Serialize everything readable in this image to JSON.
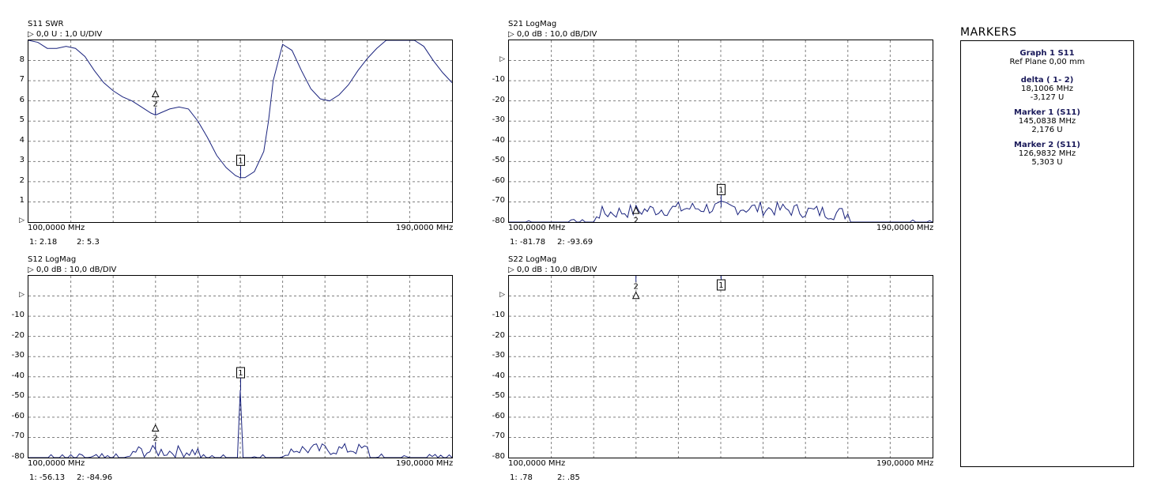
{
  "graphs": [
    {
      "id": "s11",
      "param": "S11",
      "format": "SWR",
      "scale": "0,0 U : 1,0 U/DIV",
      "y_ticks": [
        "8",
        "7",
        "6",
        "5",
        "4",
        "3",
        "2",
        "1",
        ""
      ],
      "x_start": "100,0000 MHz",
      "x_stop": "190,0000 MHz",
      "readout_1": "1:  2.18",
      "readout_2": "2:  5.3",
      "marker_1": "1",
      "marker_2": "2"
    },
    {
      "id": "s21",
      "param": "S21",
      "format": "LogMag",
      "scale": "0,0 dB : 10,0 dB/DIV",
      "y_ticks": [
        "",
        "-10",
        "-20",
        "-30",
        "-40",
        "-50",
        "-60",
        "-70",
        "-80"
      ],
      "x_start": "100,0000 MHz",
      "x_stop": "190,0000 MHz",
      "readout_1": "1:  -81.78",
      "readout_2": "2:  -93.69",
      "marker_1": "1",
      "marker_2": "2"
    },
    {
      "id": "s12",
      "param": "S12",
      "format": "LogMag",
      "scale": "0,0 dB : 10,0 dB/DIV",
      "y_ticks": [
        "",
        "-10",
        "-20",
        "-30",
        "-40",
        "-50",
        "-60",
        "-70",
        "-80"
      ],
      "x_start": "100,0000 MHz",
      "x_stop": "190,0000 MHz",
      "readout_1": "1:  -56.13",
      "readout_2": "2:  -84.96",
      "marker_1": "1",
      "marker_2": "2"
    },
    {
      "id": "s22",
      "param": "S22",
      "format": "LogMag",
      "scale": "0,0 dB : 10,0 dB/DIV",
      "y_ticks": [
        "",
        "-10",
        "-20",
        "-30",
        "-40",
        "-50",
        "-60",
        "-70",
        "-80"
      ],
      "x_start": "100,0000 MHz",
      "x_stop": "190,0000 MHz",
      "readout_1": "1:  .78",
      "readout_2": "2:  .85",
      "marker_1": "1",
      "marker_2": "2"
    }
  ],
  "markers_panel": {
    "title": "MARKERS",
    "graph_title": "Graph 1 S11",
    "ref_plane": "Ref Plane 0,00 mm",
    "delta_title": "delta ( 1- 2)",
    "delta_freq": "18,1006 MHz",
    "delta_val": "-3,127 U",
    "m1_title": "Marker  1 (S11)",
    "m1_freq": "145,0838 MHz",
    "m1_val": "2,176 U",
    "m2_title": "Marker  2 (S11)",
    "m2_freq": "126,9832 MHz",
    "m2_val": "5,303 U"
  },
  "colors": {
    "trace": "#1a237e",
    "grid": "#808080"
  },
  "chart_data": [
    {
      "type": "line",
      "title": "S11 SWR",
      "x_range_mhz": [
        100,
        190
      ],
      "ylim": [
        0,
        9
      ],
      "x": [
        100,
        102,
        104,
        106,
        108,
        110,
        112,
        114,
        116,
        118,
        120,
        122,
        124,
        126,
        127,
        128,
        130,
        132,
        134,
        136,
        138,
        140,
        142,
        144,
        145,
        146,
        148,
        150,
        151,
        152,
        154,
        156,
        158,
        160,
        162,
        164,
        166,
        168,
        170,
        172,
        174,
        176,
        178,
        180,
        182,
        184,
        186,
        188,
        190
      ],
      "series": [
        {
          "values": [
            9.5,
            8.9,
            8.6,
            8.6,
            8.7,
            8.6,
            8.2,
            7.5,
            6.9,
            6.5,
            6.2,
            6.0,
            5.7,
            5.4,
            5.3,
            5.4,
            5.6,
            5.7,
            5.6,
            5.0,
            4.2,
            3.3,
            2.7,
            2.3,
            2.2,
            2.2,
            2.5,
            3.5,
            5.0,
            7.0,
            8.8,
            8.5,
            7.5,
            6.6,
            6.1,
            6.0,
            6.3,
            6.8,
            7.5,
            8.1,
            8.6,
            9.1,
            9.4,
            9.5,
            9.3,
            8.7,
            8.0,
            7.4,
            6.9
          ]
        }
      ],
      "markers": [
        {
          "label": "1",
          "x": 145.0838,
          "y": 2.18
        },
        {
          "label": "2",
          "x": 126.9832,
          "y": 5.3
        }
      ]
    },
    {
      "type": "line",
      "title": "S21 LogMag",
      "x_range_mhz": [
        100,
        190
      ],
      "ylim": [
        -89,
        0
      ],
      "series": [
        {
          "values": "noise floor approximately -80 to -93 dB across the span"
        }
      ],
      "markers": [
        {
          "label": "1",
          "x": 145.0838,
          "y": -81.78
        },
        {
          "label": "2",
          "x": 126.9832,
          "y": -93.69
        }
      ]
    },
    {
      "type": "line",
      "title": "S12 LogMag",
      "x_range_mhz": [
        100,
        190
      ],
      "ylim": [
        -89,
        0
      ],
      "series": [
        {
          "values": "noise floor approximately -85 to -92 dB with a spike to -56 dB near 145 MHz"
        }
      ],
      "markers": [
        {
          "label": "1",
          "x": 145.0838,
          "y": -56.13
        },
        {
          "label": "2",
          "x": 126.9832,
          "y": -84.96
        }
      ]
    },
    {
      "type": "line",
      "title": "S22 LogMag",
      "x_range_mhz": [
        100,
        190
      ],
      "ylim": [
        -89,
        0
      ],
      "series": [
        {
          "values": "flat near 0 dB across the span"
        }
      ],
      "markers": [
        {
          "label": "1",
          "x": 145.0838,
          "y": 0.78
        },
        {
          "label": "2",
          "x": 126.9832,
          "y": 0.85
        }
      ]
    }
  ]
}
